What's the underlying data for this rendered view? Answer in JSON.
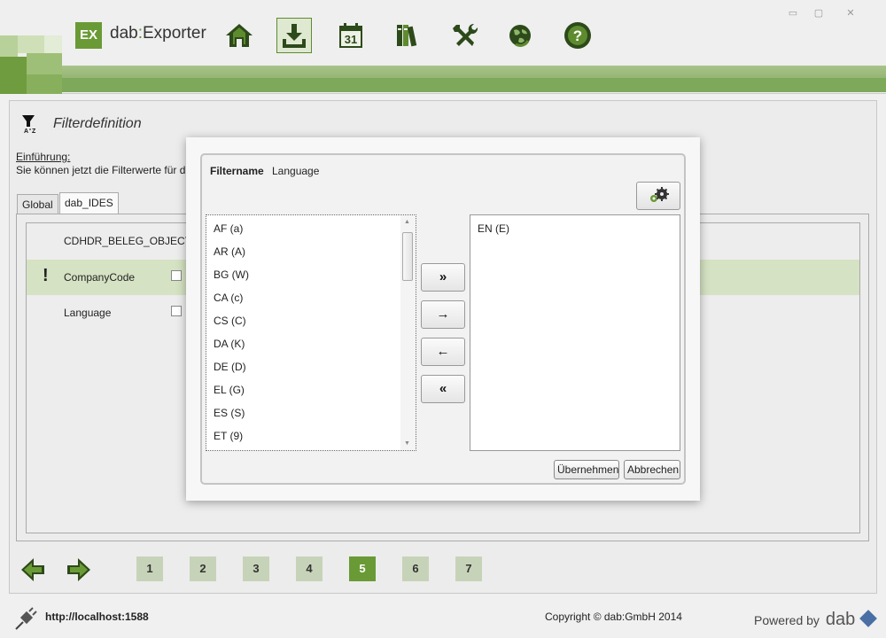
{
  "app": {
    "logo_badge": "EX",
    "logo_prefix": "dab",
    "logo_sep": ":",
    "logo_name": "Exporter",
    "brand_color": "#6a9a36",
    "accent_light": "#d5e2c3"
  },
  "nav": {
    "icons": [
      "home-icon",
      "download-icon",
      "calendar-icon",
      "library-icon",
      "tools-icon",
      "globe-icon",
      "help-icon"
    ],
    "calendar_day": "31",
    "active": "download-icon"
  },
  "window": {
    "minimize": "▭",
    "restore": "▢",
    "close": "✕"
  },
  "panel": {
    "title": "Filterdefinition",
    "intro_heading": "Einführung:",
    "intro_text": "Sie können jetzt die Filterwerte für d"
  },
  "tabs": [
    {
      "label": "Global",
      "active": false
    },
    {
      "label": "dab_IDES",
      "active": true
    }
  ],
  "rows": [
    {
      "label": "CDHDR_BELEG_OBJECTID",
      "warning": "",
      "checked": false,
      "highlight": false
    },
    {
      "label": "CompanyCode",
      "warning": "!",
      "checked": false,
      "highlight": true
    },
    {
      "label": "Language",
      "warning": "",
      "checked": false,
      "highlight": false
    }
  ],
  "pager": {
    "pages": [
      "1",
      "2",
      "3",
      "4",
      "5",
      "6",
      "7"
    ],
    "current": "5"
  },
  "footer": {
    "url": "http://localhost:1588",
    "copyright": "Copyright © dab:GmbH 2014",
    "powered_by": "Powered by",
    "powered_brand": "dab"
  },
  "dialog": {
    "filtername_label": "Filtername",
    "filtername_value": "Language",
    "available": [
      "AF (a)",
      "AR (A)",
      "BG (W)",
      "CA (c)",
      "CS (C)",
      "DA (K)",
      "DE (D)",
      "EL (G)",
      "ES (S)",
      "ET (9)"
    ],
    "selected": [
      "EN (E)"
    ],
    "btn_add_all": "»",
    "btn_add": "→",
    "btn_remove": "←",
    "btn_remove_all": "«",
    "apply": "Übernehmen",
    "cancel": "Abbrechen"
  }
}
